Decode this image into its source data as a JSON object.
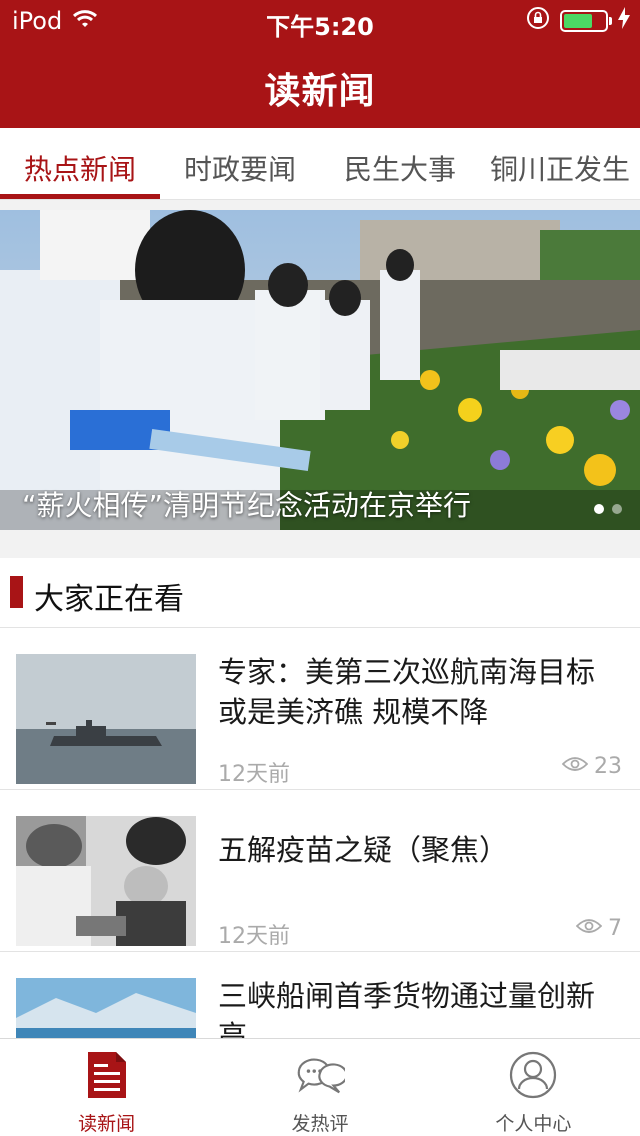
{
  "status_bar": {
    "carrier": "iPod",
    "time": "下午5:20",
    "battery_fill": 0.7
  },
  "header": {
    "title": "读新闻"
  },
  "tabs": [
    {
      "label": "热点新闻",
      "active": true
    },
    {
      "label": "时政要闻",
      "active": false
    },
    {
      "label": "民生大事",
      "active": false
    },
    {
      "label": "铜川正发生",
      "active": false
    }
  ],
  "banner": {
    "caption": "“薪火相传”清明节纪念活动在京举行",
    "slide_count": 2,
    "active_slide": 1
  },
  "section": {
    "title": "大家正在看",
    "items": [
      {
        "title": "专家：美第三次巡航南海目标或是美济礁 规模不降",
        "time": "12天前",
        "views": "23"
      },
      {
        "title": "五解疫苗之疑（聚焦）",
        "time": "12天前",
        "views": "7"
      },
      {
        "title": "三峡船闸首季货物通过量创新高",
        "time": "",
        "views": ""
      }
    ]
  },
  "nav": [
    {
      "label": "读新闻",
      "icon": "document-icon",
      "active": true
    },
    {
      "label": "发热评",
      "icon": "chat-bubbles-icon",
      "active": false
    },
    {
      "label": "个人中心",
      "icon": "user-profile-icon",
      "active": false
    }
  ],
  "colors": {
    "brand": "#a81416",
    "battery": "#4cd964"
  }
}
